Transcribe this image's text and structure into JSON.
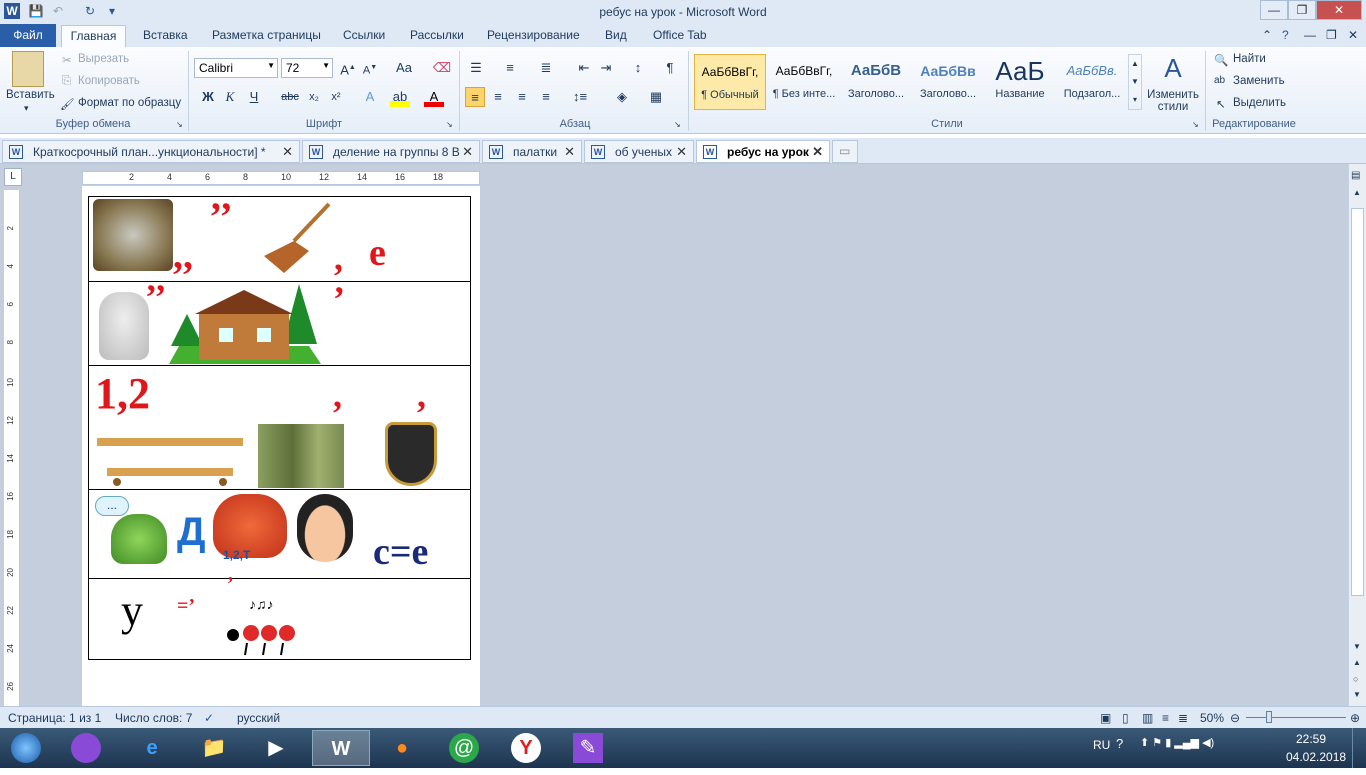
{
  "window": {
    "title": "ребус на урок  -  Microsoft Word"
  },
  "ribbon_tabs": [
    "Файл",
    "Главная",
    "Вставка",
    "Разметка страницы",
    "Ссылки",
    "Рассылки",
    "Рецензирование",
    "Вид",
    "Office Tab"
  ],
  "clipboard": {
    "paste": "Вставить",
    "cut": "Вырезать",
    "copy": "Копировать",
    "format_painter": "Формат по образцу",
    "group": "Буфер обмена"
  },
  "font": {
    "name": "Calibri",
    "size": "72",
    "group": "Шрифт"
  },
  "paragraph": {
    "group": "Абзац"
  },
  "styles": {
    "items": [
      {
        "preview": "АаБбВвГг,",
        "name": "¶ Обычный"
      },
      {
        "preview": "АаБбВвГг,",
        "name": "¶ Без инте..."
      },
      {
        "preview": "АаБбВ",
        "name": "Заголово..."
      },
      {
        "preview": "АаБбВв",
        "name": "Заголово..."
      },
      {
        "preview": "АаБ",
        "name": "Название"
      },
      {
        "preview": "АаБбВв.",
        "name": "Подзагол..."
      }
    ],
    "change": "Изменить стили",
    "group": "Стили"
  },
  "editing": {
    "find": "Найти",
    "replace": "Заменить",
    "select": "Выделить",
    "group": "Редактирование"
  },
  "doc_tabs": [
    "Краткосрочный план...ункциональности] *",
    "деление на группы 8 В",
    "палатки",
    "об ученых",
    "ребус на урок"
  ],
  "ruler_labels": [
    "2",
    "4",
    "6",
    "8",
    "10",
    "12",
    "14",
    "16",
    "18"
  ],
  "vruler_labels": [
    "2",
    "4",
    "6",
    "8",
    "10",
    "12",
    "14",
    "16",
    "18",
    "20",
    "22",
    "24",
    "26"
  ],
  "rebus": {
    "row1": {
      "commas_top": "’’",
      "commas_bottom": ",,",
      "comma": ",",
      "letter": "е"
    },
    "row2": {
      "commas_left": "’’",
      "comma_right": "’"
    },
    "row3": {
      "numbers": "1,2",
      "comma1": ",",
      "comma2": ","
    },
    "row4": {
      "bubble": "...",
      "letter": "Д",
      "crab_label": "1,2,Т",
      "equation": "с=е"
    },
    "row5": {
      "letter": "у",
      "equals": "=’",
      "comma": "’"
    }
  },
  "status": {
    "page": "Страница: 1 из 1",
    "words": "Число слов: 7",
    "lang": "русский",
    "zoom": "50%"
  },
  "taskbar": {
    "lang": "RU",
    "time": "22:59",
    "date": "04.02.2018"
  }
}
